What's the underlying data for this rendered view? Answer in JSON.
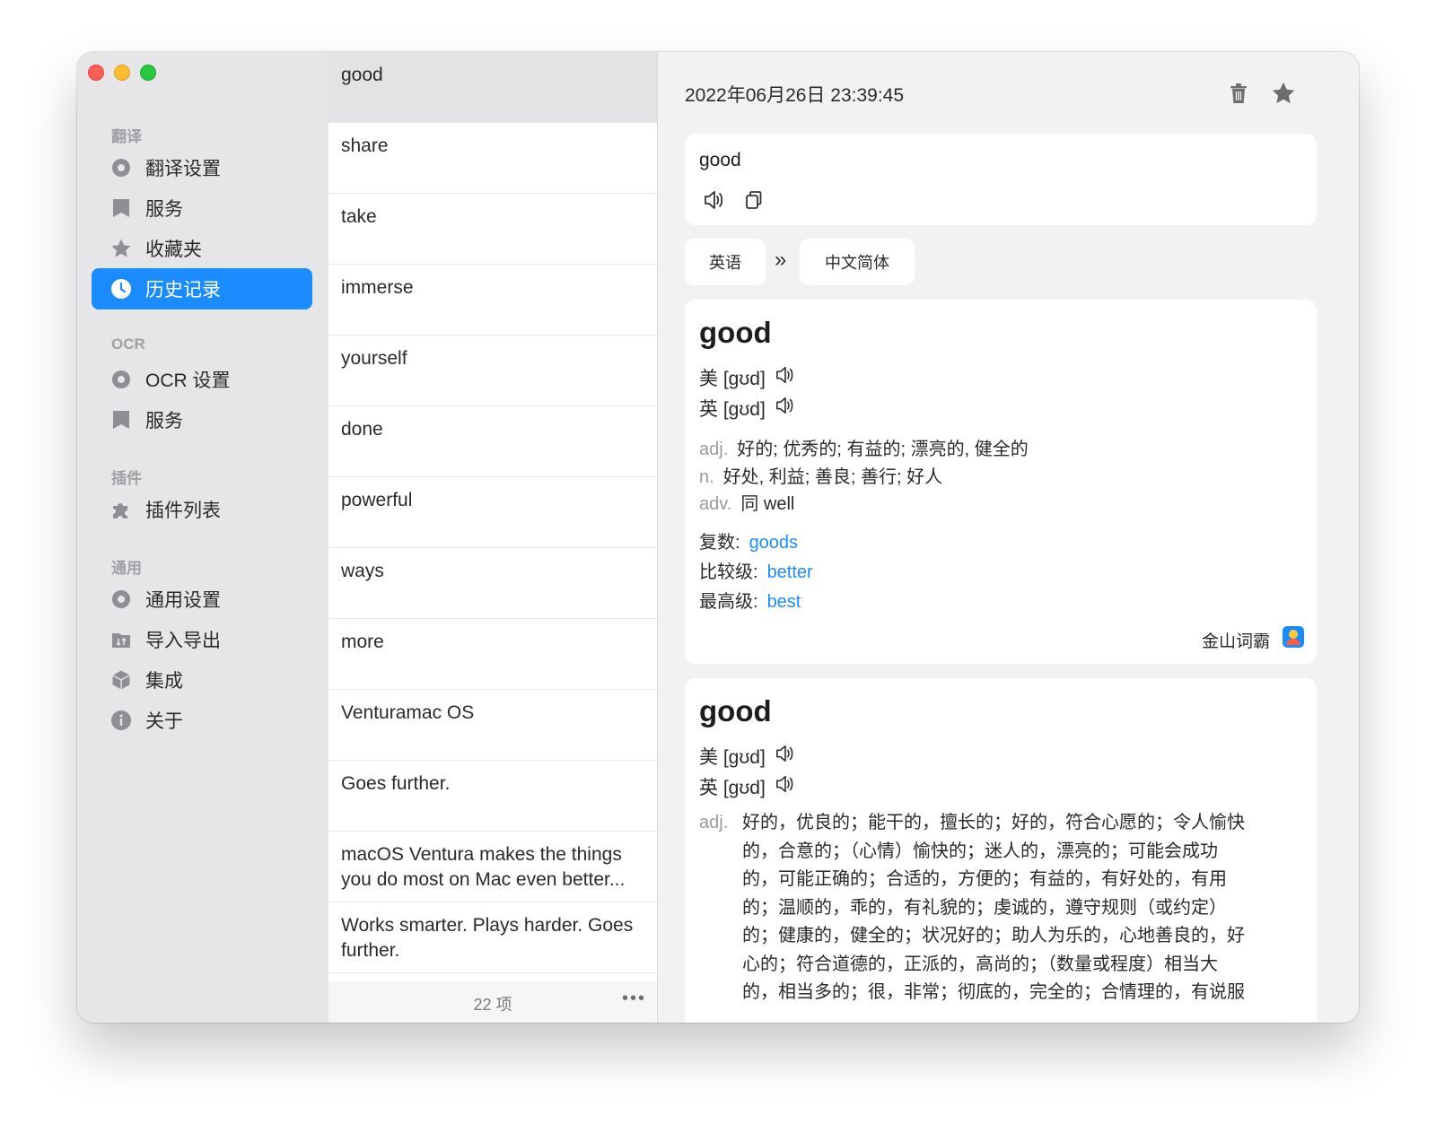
{
  "sidebar": {
    "sections": [
      {
        "label": "翻译",
        "items": [
          {
            "label": "翻译设置",
            "icon": "gear-icon"
          },
          {
            "label": "服务",
            "icon": "bookmark-icon"
          },
          {
            "label": "收藏夹",
            "icon": "star-icon"
          },
          {
            "label": "历史记录",
            "icon": "clock-icon",
            "active": true
          }
        ]
      },
      {
        "label": "OCR",
        "items": [
          {
            "label": "OCR 设置",
            "icon": "gear-icon"
          },
          {
            "label": "服务",
            "icon": "bookmark-icon"
          }
        ]
      },
      {
        "label": "插件",
        "items": [
          {
            "label": "插件列表",
            "icon": "puzzle-icon"
          }
        ]
      },
      {
        "label": "通用",
        "items": [
          {
            "label": "通用设置",
            "icon": "gear-icon"
          },
          {
            "label": "导入导出",
            "icon": "import-export-icon"
          },
          {
            "label": "集成",
            "icon": "cube-icon"
          },
          {
            "label": "关于",
            "icon": "info-icon"
          }
        ]
      }
    ]
  },
  "history": {
    "items": [
      "good",
      "share",
      "take",
      "immerse",
      "yourself",
      "done",
      "powerful",
      "ways",
      "more",
      "Venturamac OS",
      "Goes further.",
      "macOS Ventura makes the things you do most on Mac even better...",
      "Works smarter. Plays harder. Goes further."
    ],
    "count_label": "22 项",
    "more_label": "•••"
  },
  "detail": {
    "datetime": "2022年06月26日 23:39:45",
    "source_text": "good",
    "from_lang": "英语",
    "arrow": "»",
    "to_lang": "中文简体",
    "card1": {
      "word": "good",
      "us_phonetic": "美 [gʊd]",
      "uk_phonetic": "英 [gʊd]",
      "definitions": [
        {
          "pos": "adj.",
          "text": "好的; 优秀的; 有益的; 漂亮的, 健全的"
        },
        {
          "pos": "n.",
          "text": "好处, 利益; 善良; 善行; 好人"
        },
        {
          "pos": "adv.",
          "text": "同 well"
        }
      ],
      "forms": [
        {
          "label": "复数:",
          "value": "goods"
        },
        {
          "label": "比较级:",
          "value": "better"
        },
        {
          "label": "最高级:",
          "value": "best"
        }
      ],
      "source": "金山词霸"
    },
    "card2": {
      "word": "good",
      "us_phonetic": "美 [gʊd]",
      "uk_phonetic": "英 [gʊd]",
      "pos": "adj.",
      "lines": [
        "好的，优良的；能干的，擅长的；好的，符合心愿的；令人愉快",
        "的，合意的；（心情）愉快的；迷人的，漂亮的；可能会成功",
        "的，可能正确的；合适的，方便的；有益的，有好处的，有用",
        "的；温顺的，乖的，有礼貌的；虔诚的，遵守规则（或约定）",
        "的；健康的，健全的；状况好的；助人为乐的，心地善良的，好",
        "心的；符合道德的，正派的，高尚的；（数量或程度）相当大",
        "的，相当多的；很，非常；彻底的，完全的；合情理的，有说服"
      ]
    }
  },
  "colors": {
    "accent": "#1a8cff"
  }
}
